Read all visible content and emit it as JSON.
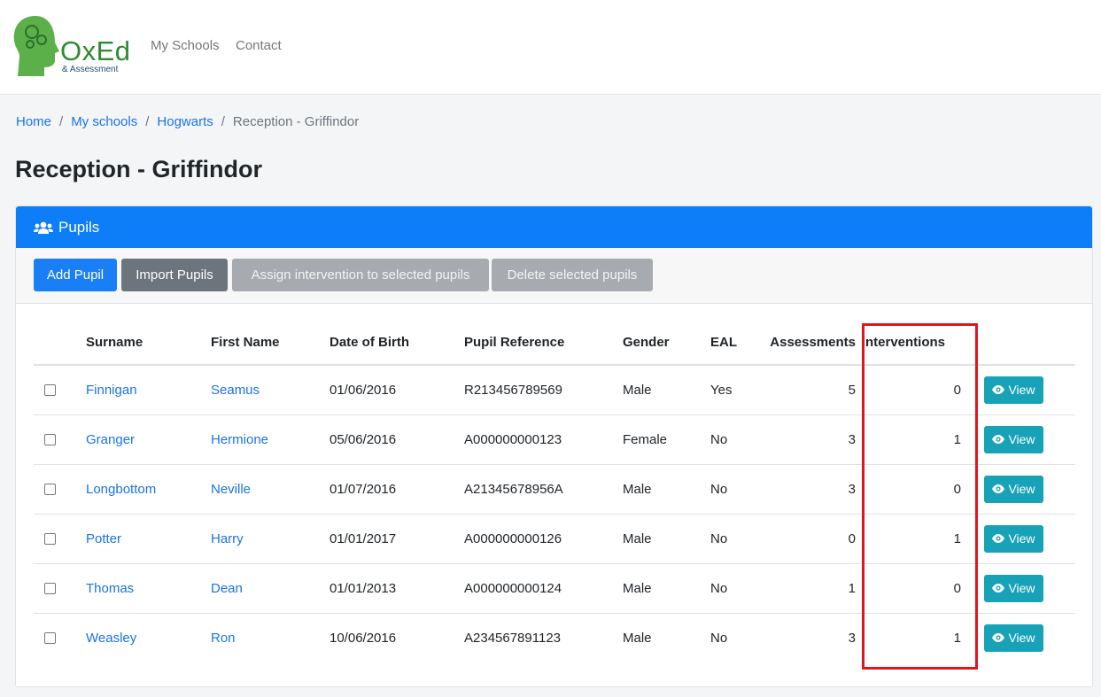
{
  "brand": {
    "name": "OxEd",
    "sub": "& Assessment"
  },
  "nav": {
    "items": [
      "My Schools",
      "Contact"
    ]
  },
  "breadcrumb": {
    "items": [
      "Home",
      "My schools",
      "Hogwarts"
    ],
    "active": "Reception - Griffindor"
  },
  "page": {
    "title": "Reception - Griffindor"
  },
  "card": {
    "title": "Pupils"
  },
  "toolbar": {
    "add": "Add Pupil",
    "import": "Import Pupils",
    "assign": "Assign intervention to selected pupils",
    "delete": "Delete selected pupils"
  },
  "table": {
    "headers": [
      "Surname",
      "First Name",
      "Date of Birth",
      "Pupil Reference",
      "Gender",
      "EAL",
      "Assessments",
      "Interventions"
    ],
    "view_label": "View",
    "rows": [
      {
        "surname": "Finnigan",
        "first": "Seamus",
        "dob": "01/06/2016",
        "ref": "R213456789569",
        "gender": "Male",
        "eal": "Yes",
        "assessments": "5",
        "interventions": "0"
      },
      {
        "surname": "Granger",
        "first": "Hermione",
        "dob": "05/06/2016",
        "ref": "A000000000123",
        "gender": "Female",
        "eal": "No",
        "assessments": "3",
        "interventions": "1"
      },
      {
        "surname": "Longbottom",
        "first": "Neville",
        "dob": "01/07/2016",
        "ref": "A21345678956A",
        "gender": "Male",
        "eal": "No",
        "assessments": "3",
        "interventions": "0"
      },
      {
        "surname": "Potter",
        "first": "Harry",
        "dob": "01/01/2017",
        "ref": "A000000000126",
        "gender": "Male",
        "eal": "No",
        "assessments": "0",
        "interventions": "1"
      },
      {
        "surname": "Thomas",
        "first": "Dean",
        "dob": "01/01/2013",
        "ref": "A000000000124",
        "gender": "Male",
        "eal": "No",
        "assessments": "1",
        "interventions": "0"
      },
      {
        "surname": "Weasley",
        "first": "Ron",
        "dob": "10/06/2016",
        "ref": "A234567891123",
        "gender": "Male",
        "eal": "No",
        "assessments": "3",
        "interventions": "1"
      }
    ]
  },
  "colors": {
    "primary": "#1a7ef6",
    "header": "#0d7ef8",
    "info": "#17a2b8",
    "highlight": "#e0151f",
    "brand_green": "#2e8b2e"
  }
}
